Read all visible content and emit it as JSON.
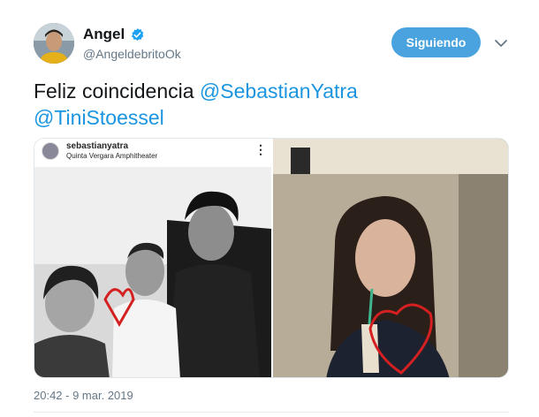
{
  "author": {
    "display_name": "Angel",
    "handle": "@AngeldebritoOk",
    "verified": true,
    "avatar_icon": "profile-photo"
  },
  "follow_button": {
    "label": "Siguiendo",
    "color": "#4aa3df"
  },
  "menu_icon": "chevron-down-icon",
  "tweet": {
    "text_prefix": "Feliz coincidencia ",
    "mention_1": "@SebastianYatra",
    "mention_2": "@TiniStoessel",
    "mention_color": "#1b95e0",
    "timestamp": "20:42 - 9 mar. 2019"
  },
  "media": {
    "left_photo": {
      "ig_username": "sebastianyatra",
      "ig_location": "Quinta Vergara Amphitheater",
      "more_icon": "⋮",
      "style": "black-and-white group photo with red heart drawing"
    },
    "right_photo": {
      "style": "color photo with red heart drawing"
    }
  }
}
